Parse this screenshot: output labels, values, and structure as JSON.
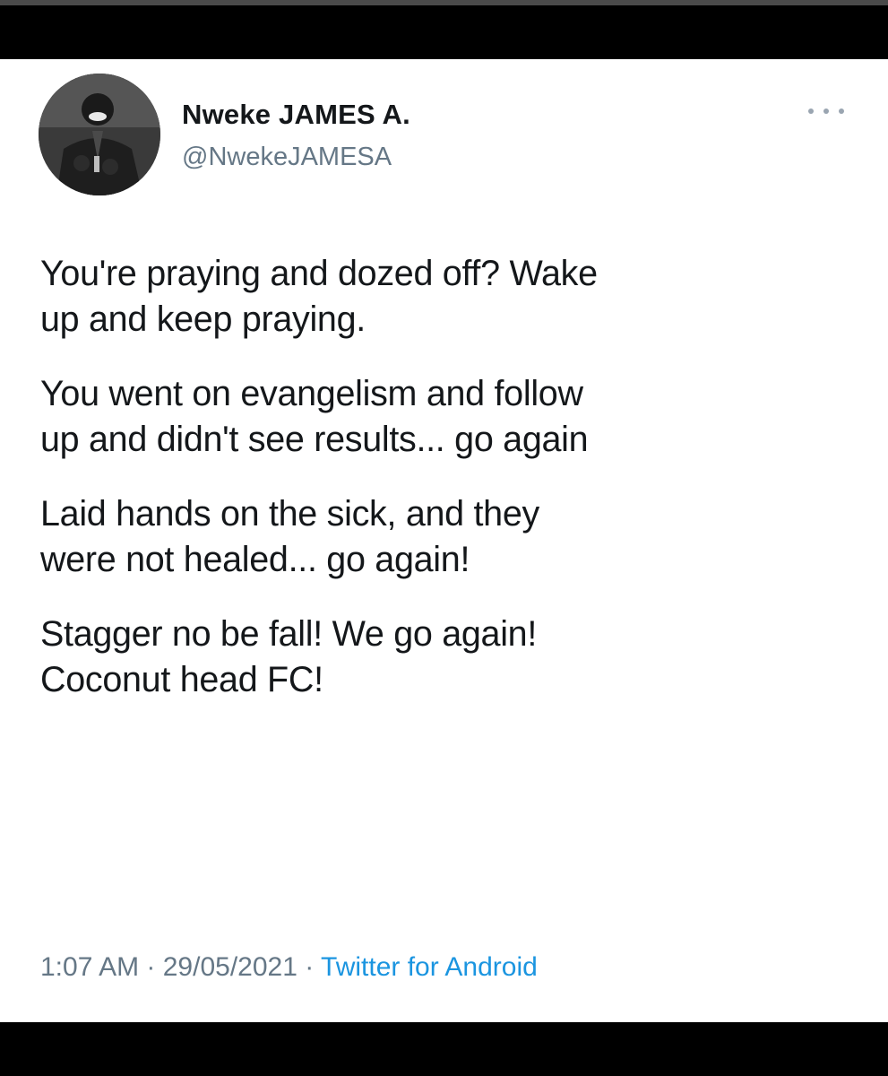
{
  "author": {
    "display_name": "Nweke JAMES A.",
    "handle": "@NwekeJAMESA"
  },
  "more_icon": "more-horizontal-icon",
  "tweet": {
    "paragraphs": [
      [
        "You're praying and dozed off? Wake",
        "up and keep praying."
      ],
      [
        "You went on evangelism and follow",
        "up and didn't see results... go again"
      ],
      [
        "Laid hands on the sick,  and they",
        "were not healed... go again!"
      ],
      [
        "Stagger no be fall! We go again!",
        "Coconut head FC!"
      ]
    ]
  },
  "meta": {
    "time": "1:07 AM",
    "separator": " · ",
    "date": "29/05/2021",
    "source": "Twitter for Android"
  },
  "colors": {
    "text_primary": "#14171a",
    "text_secondary": "#657786",
    "link": "#1b95e0",
    "background": "#ffffff",
    "frame": "#000000"
  }
}
